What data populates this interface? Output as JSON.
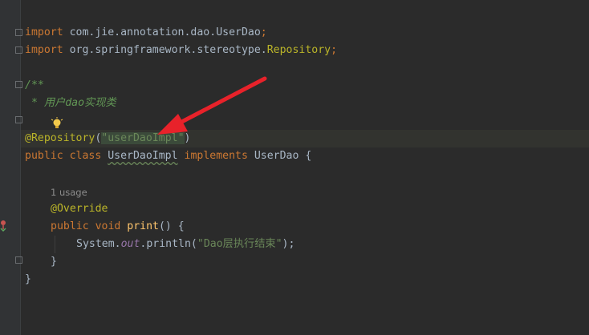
{
  "hint": "1 usage",
  "lines": {
    "l1": {
      "t1": "import ",
      "t2": "com.jie.annotation.dao.UserDao",
      "t3": ";"
    },
    "l2": {
      "t1": "import ",
      "t2": "org.springframework.stereotype.",
      "t3": "Repository",
      "t4": ";"
    },
    "l3": {
      "t1": "/**"
    },
    "l4": {
      "t1": " * 用户dao实现类"
    },
    "l5": {
      "t1": "@Repository",
      "t2": "(",
      "t3": "\"userDaoImpl\"",
      "t4": ")"
    },
    "l6": {
      "t1": "public class ",
      "t2": "UserDaoImpl",
      "t3": " implements ",
      "t4": "UserDao {"
    },
    "l7": {
      "t1": "@Override"
    },
    "l8": {
      "t1": "public void ",
      "t2": "print",
      "t3": "() {"
    },
    "l9": {
      "t1": "System.",
      "t2": "out",
      "t3": ".println(",
      "t4": "\"Dao层执行结束\"",
      "t5": ");"
    },
    "l10": {
      "t1": "}"
    },
    "l11": {
      "t1": "}"
    }
  },
  "colors": {
    "keyword": "#cc7832",
    "annotation": "#bbb529",
    "string": "#6a8759",
    "arrow": "#e8222a"
  }
}
